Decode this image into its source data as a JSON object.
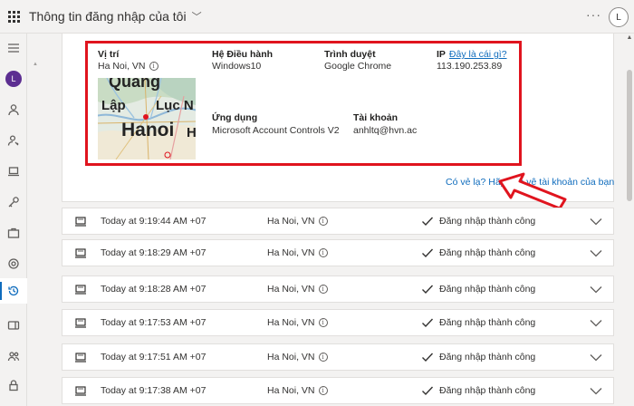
{
  "header": {
    "title": "Thông tin đăng nhập của tôi",
    "avatar_initial": "L",
    "more_label": "···"
  },
  "rail": {
    "avatar_initial": "L"
  },
  "details": {
    "location_label": "Vị trí",
    "location_value": "Ha Noi, VN",
    "os_label": "Hệ Điều hành",
    "os_value": "Windows10",
    "browser_label": "Trình duyệt",
    "browser_value": "Google Chrome",
    "ip_label": "IP",
    "ip_link": "Đây là cái gì?",
    "ip_value": "113.190.253.89",
    "app_label": "Ứng dụng",
    "app_value": "Microsoft Account Controls V2",
    "account_label": "Tài khoản",
    "account_value": "anhltq@hvn.ac",
    "map_labels": [
      "Quang",
      "Lập",
      "Lục N",
      "Hanoi",
      "H"
    ]
  },
  "hint": {
    "text": "Có vẻ lạ? Hãy bảo vệ tài khoản của bạn"
  },
  "accent": {
    "highlight": "#e0141e",
    "link": "#0f6cbd"
  },
  "activity": [
    {
      "time": "Today at 9:19:44 AM +07",
      "location": "Ha Noi, VN",
      "status": "Đăng nhập thành công"
    },
    {
      "time": "Today at 9:18:29 AM +07",
      "location": "Ha Noi, VN",
      "status": "Đăng nhập thành công"
    },
    {
      "time": "Today at 9:18:28 AM +07",
      "location": "Ha Noi, VN",
      "status": "Đăng nhập thành công"
    },
    {
      "time": "Today at 9:17:53 AM +07",
      "location": "Ha Noi, VN",
      "status": "Đăng nhập thành công"
    },
    {
      "time": "Today at 9:17:51 AM +07",
      "location": "Ha Noi, VN",
      "status": "Đăng nhập thành công"
    },
    {
      "time": "Today at 9:17:38 AM +07",
      "location": "Ha Noi, VN",
      "status": "Đăng nhập thành công"
    }
  ]
}
